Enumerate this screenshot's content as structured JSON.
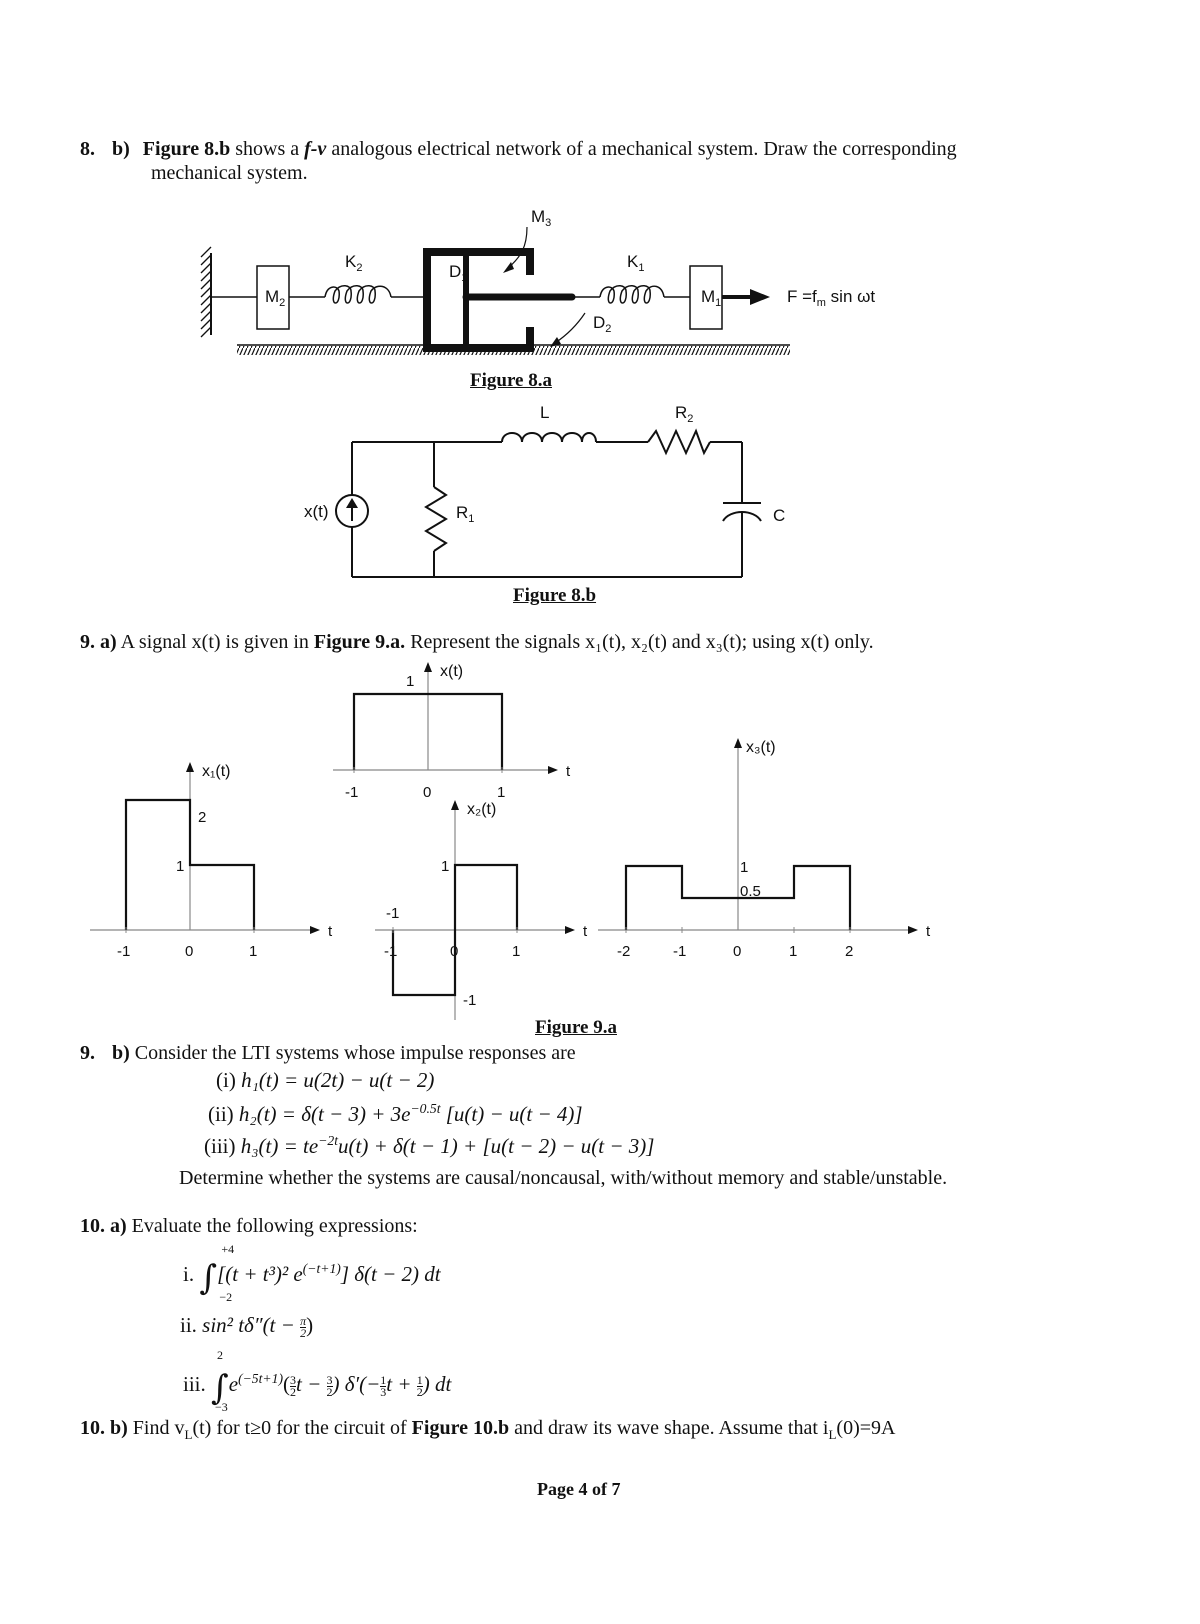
{
  "q8b": {
    "number": "8.",
    "part": "b)",
    "fig_ref": "Figure 8.b",
    "text1_a": " shows a ",
    "fv": "f-v",
    "text1_b": " analogous electrical network of a mechanical system. Draw the corresponding",
    "text2": "mechanical system."
  },
  "fig8a": {
    "caption": "Figure 8.a",
    "labels": {
      "M1": "M",
      "M1_sub": "1",
      "M2": "M",
      "M2_sub": "2",
      "M3": "M",
      "M3_sub": "3",
      "K1": "K",
      "K1_sub": "1",
      "K2": "K",
      "K2_sub": "2",
      "D1": "D",
      "D1_sub": "1",
      "D2": "D",
      "D2_sub": "2",
      "force_a": "F =f",
      "force_sub": "m",
      "force_b": " sin ωt"
    }
  },
  "fig8b": {
    "caption": "Figure 8.b",
    "labels": {
      "source": "x(t)",
      "R1": "R",
      "R1_sub": "1",
      "R2": "R",
      "R2_sub": "2",
      "L": "L",
      "C": "C"
    }
  },
  "q9a": {
    "number": "9.",
    "part": "a)",
    "text_a": " A signal x(t) is given in ",
    "fig_ref": "Figure 9.a.",
    "text_b": "  Represent the signals x₁(t), x₂(t) and x₃(t); using x(t) only."
  },
  "fig9a": {
    "caption": "Figure 9.a"
  },
  "chart_data": [
    {
      "type": "line",
      "title": "x(t)",
      "xlabel": "t",
      "ylabel": "x(t)",
      "x": [
        -1,
        -1,
        1,
        1
      ],
      "y": [
        0,
        1,
        1,
        0
      ],
      "x_ticks": [
        "-1",
        "0",
        "1"
      ],
      "y_ticks": [
        "1"
      ]
    },
    {
      "type": "line",
      "title": "x1(t)",
      "xlabel": "t",
      "ylabel": "x₁(t)",
      "x": [
        -1,
        -1,
        0,
        0,
        1,
        1
      ],
      "y": [
        0,
        2,
        2,
        1,
        1,
        0
      ],
      "x_ticks": [
        "-1",
        "0",
        "1"
      ],
      "y_ticks": [
        "1",
        "2"
      ]
    },
    {
      "type": "line",
      "title": "x2(t)",
      "xlabel": "t",
      "ylabel": "x₂(t)",
      "x": [
        -1,
        -1,
        0,
        0,
        1,
        1
      ],
      "y": [
        0,
        -1,
        -1,
        1,
        1,
        0
      ],
      "x_ticks": [
        "-1",
        "0",
        "1"
      ],
      "y_ticks": [
        "1",
        "-1"
      ]
    },
    {
      "type": "line",
      "title": "x3(t)",
      "xlabel": "t",
      "ylabel": "x₃(t)",
      "x": [
        -2,
        -2,
        -1,
        -1,
        1,
        1,
        2,
        2
      ],
      "y": [
        0,
        1,
        1,
        0.5,
        0.5,
        1,
        1,
        0
      ],
      "x_ticks": [
        "-2",
        "-1",
        "0",
        "1",
        "2"
      ],
      "y_ticks": [
        "1",
        "0.5"
      ]
    }
  ],
  "q9b": {
    "number": "9.",
    "part": "b)",
    "text": " Consider the LTI systems whose impulse responses are",
    "items": [
      {
        "label": "(i)",
        "expr": "h₁(t) = u(2t) − u(t − 2)"
      },
      {
        "label": "(ii)",
        "expr_a": "h₂(t) = δ(t − 3) + 3e",
        "expr_sup": "−0.5t",
        "expr_b": " [u(t) − u(t − 4)]"
      },
      {
        "label": "(iii)",
        "expr_a": "h₃(t) = te",
        "expr_sup": "−2t",
        "expr_b": "u(t) + δ(t − 1) + [u(t − 2) − u(t − 3)]"
      }
    ],
    "determine": "Determine whether the systems are causal/noncausal, with/without memory and stable/unstable."
  },
  "q10a": {
    "number": "10.",
    "part": "a)",
    "text": " Evaluate the following expressions:",
    "i": {
      "label": "i.",
      "upper": "+4",
      "lower": "−2",
      "expr_a": "[(t + t³)² e",
      "expr_sup": "(−t+1)",
      "expr_b": "] δ(t − 2) dt"
    },
    "ii": {
      "label": "ii.",
      "expr_a": "sin² tδ″(t − ",
      "num": "π",
      "den": "2",
      "expr_b": ")"
    },
    "iii": {
      "label": "iii.",
      "upper": "2",
      "lower": "−3",
      "expr_a": "e",
      "expr_sup": "(−5t+1)",
      "p1": "(",
      "f1n": "3",
      "f1d": "2",
      "p2": "t − ",
      "f2n": "3",
      "f2d": "2",
      "p3": ") δ′(−",
      "f3n": "1",
      "f3d": "3",
      "p4": "t + ",
      "f4n": "1",
      "f4d": "2",
      "p5": ") dt"
    }
  },
  "q10b": {
    "number": "10.",
    "part": "b)",
    "text_a": " Find v",
    "sub1": "L",
    "text_b": "(t) for t≥0 for the circuit of ",
    "fig_ref": "Figure 10.b",
    "text_c": " and draw its wave shape. Assume that i",
    "sub2": "L",
    "text_d": "(0)=9A"
  },
  "footer": {
    "page": "Page 4 of 7"
  }
}
